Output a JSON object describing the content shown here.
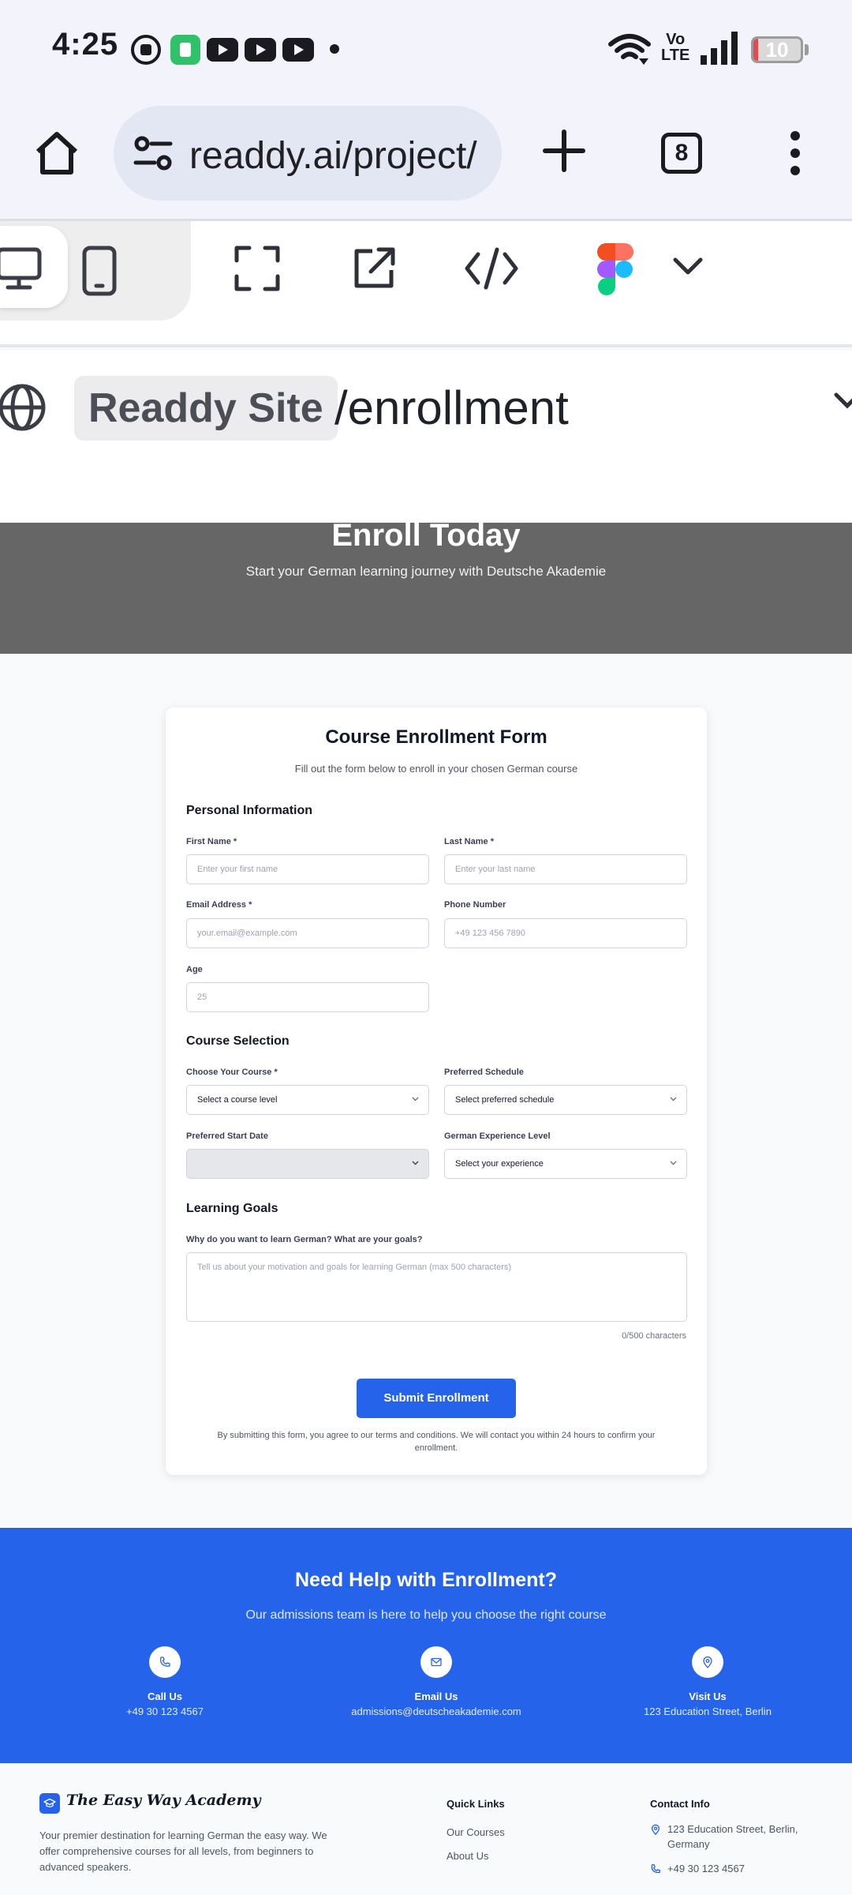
{
  "status_bar": {
    "time": "4:25",
    "network": "Vo\nLTE",
    "battery": "10",
    "battery_level": 0.1
  },
  "browser": {
    "url": "readdy.ai/project/",
    "tab_count": "8"
  },
  "route": {
    "site_chip": "Readdy Site",
    "path": "/enrollment"
  },
  "hero": {
    "title": "Enroll Today",
    "subtitle": "Start your German learning journey with Deutsche Akademie"
  },
  "form": {
    "title": "Course Enrollment Form",
    "subtitle": "Fill out the form below to enroll in your chosen German course",
    "personal": {
      "heading": "Personal Information",
      "first_name_label": "First Name *",
      "first_name_placeholder": "Enter your first name",
      "last_name_label": "Last Name *",
      "last_name_placeholder": "Enter your last name",
      "email_label": "Email Address *",
      "email_placeholder": "your.email@example.com",
      "phone_label": "Phone Number",
      "phone_placeholder": "+49 123 456 7890",
      "age_label": "Age",
      "age_placeholder": "25"
    },
    "course": {
      "heading": "Course Selection",
      "course_label": "Choose Your Course *",
      "course_value": "Select a course level",
      "schedule_label": "Preferred Schedule",
      "schedule_value": "Select preferred schedule",
      "start_label": "Preferred Start Date",
      "start_value": "",
      "experience_label": "German Experience Level",
      "experience_value": "Select your experience"
    },
    "goals": {
      "heading": "Learning Goals",
      "question": "Why do you want to learn German? What are your goals?",
      "placeholder": "Tell us about your motivation and goals for learning German (max 500 characters)",
      "char_count": "0/500 characters"
    },
    "submit_label": "Submit Enrollment",
    "terms": "By submitting this form, you agree to our terms and conditions. We will contact you within 24 hours to confirm your enrollment."
  },
  "help": {
    "title": "Need Help with Enrollment?",
    "subtitle": "Our admissions team is here to help you choose the right course",
    "contacts": [
      {
        "title": "Call Us",
        "value": "+49 30 123 4567",
        "icon": "phone-icon"
      },
      {
        "title": "Email Us",
        "value": "admissions@deutscheakademie.com",
        "icon": "mail-icon"
      },
      {
        "title": "Visit Us",
        "value": "123 Education Street, Berlin",
        "icon": "map-pin-icon"
      }
    ]
  },
  "footer": {
    "brand": "The Easy Way Academy",
    "description": "Your premier destination for learning German the easy way. We offer comprehensive courses for all levels, from beginners to advanced speakers.",
    "quick_links_title": "Quick Links",
    "quick_links": [
      "Our Courses",
      "About Us"
    ],
    "contact_title": "Contact Info",
    "contact_address": "123 Education Street, Berlin, Germany",
    "contact_phone": "+49 30 123 4567"
  },
  "colors": {
    "primary": "#2563eb",
    "hero_bg": "#666666"
  }
}
